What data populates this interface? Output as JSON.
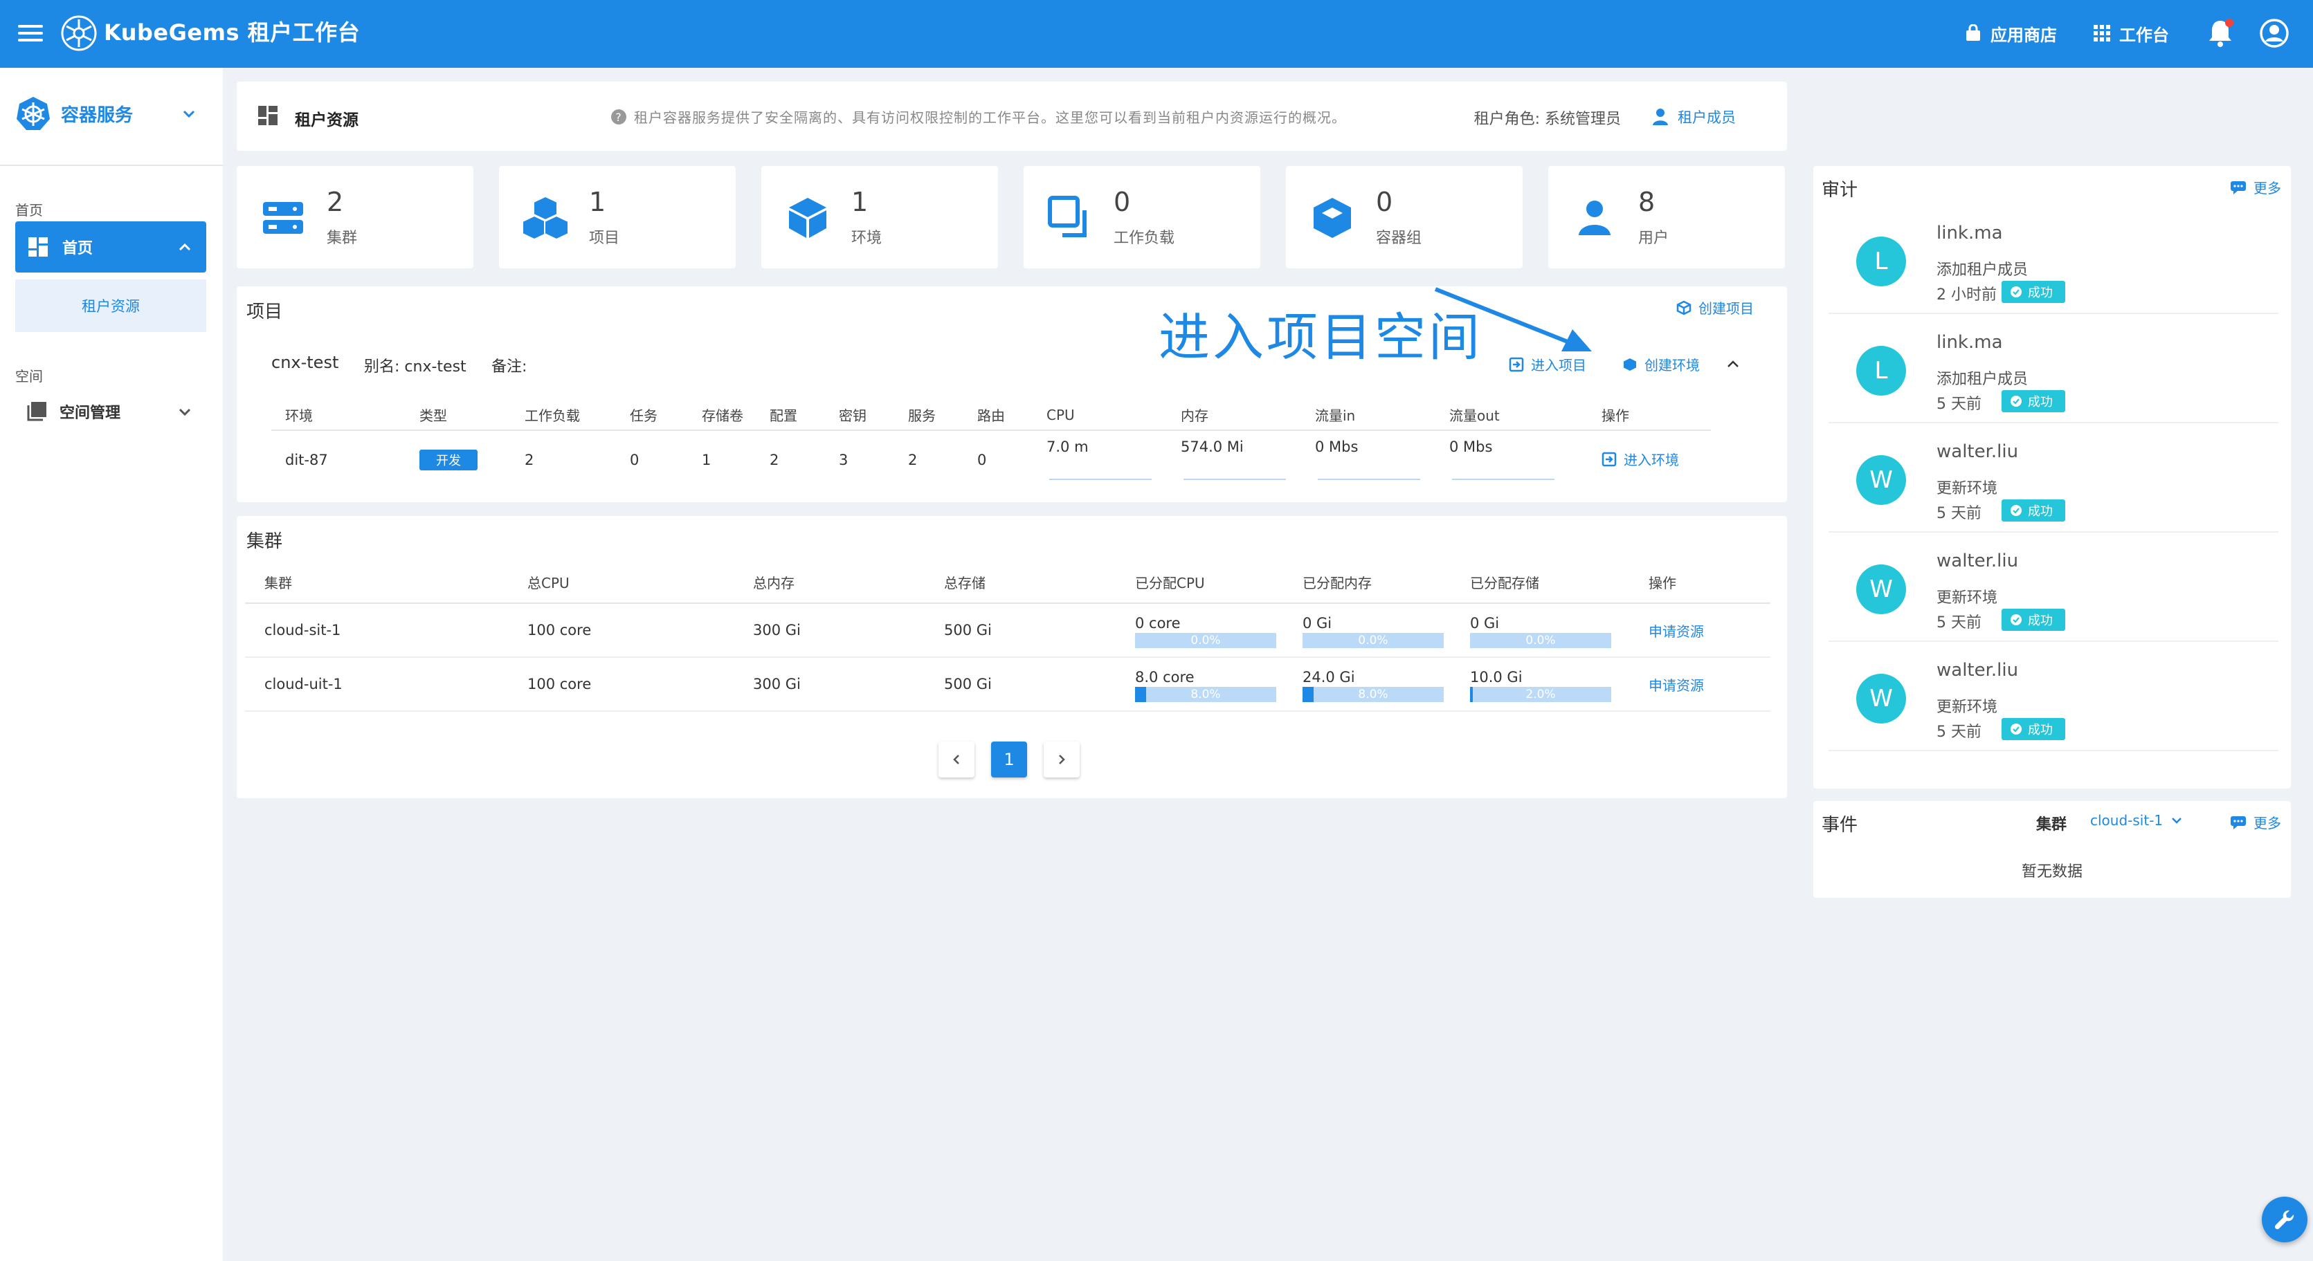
{
  "topbar": {
    "brand": "KubeGems 租户工作台",
    "app_store": "应用商店",
    "workbench": "工作台"
  },
  "sidebar": {
    "project": "容器服务",
    "section_home": "首页",
    "home_label": "首页",
    "home_sub": "租户资源",
    "section_space": "空间",
    "space_mgmt": "空间管理"
  },
  "header": {
    "title": "租户资源",
    "help": "租户容器服务提供了安全隔离的、具有访问权限控制的工作平台。这里您可以看到当前租户内资源运行的概况。",
    "role": "租户角色: 系统管理员",
    "members": "租户成员"
  },
  "stats": [
    {
      "value": "2",
      "label": "集群"
    },
    {
      "value": "1",
      "label": "项目"
    },
    {
      "value": "1",
      "label": "环境"
    },
    {
      "value": "0",
      "label": "工作负载"
    },
    {
      "value": "0",
      "label": "容器组"
    },
    {
      "value": "8",
      "label": "用户"
    }
  ],
  "projects": {
    "title": "项目",
    "create_project": "创建项目",
    "annotation": "进入项目空间",
    "name": "cnx-test",
    "alias": "别名: cnx-test",
    "remark": "备注:",
    "enter_project": "进入项目",
    "create_env": "创建环境",
    "columns": [
      "环境",
      "类型",
      "工作负载",
      "任务",
      "存储卷",
      "配置",
      "密钥",
      "服务",
      "路由",
      "CPU",
      "内存",
      "流量in",
      "流量out",
      "操作"
    ],
    "row": {
      "env": "dit-87",
      "type": "开发",
      "workloads": "2",
      "jobs": "0",
      "volumes": "1",
      "configs": "2",
      "secrets": "3",
      "services": "2",
      "routes": "0",
      "cpu": "7.0 m",
      "memory": "574.0 Mi",
      "traffic_in": "0 Mbs",
      "traffic_out": "0 Mbs",
      "action": "进入环境"
    }
  },
  "clusters": {
    "title": "集群",
    "columns": [
      "集群",
      "总CPU",
      "总内存",
      "总存储",
      "已分配CPU",
      "已分配内存",
      "已分配存储",
      "操作"
    ],
    "rows": [
      {
        "name": "cloud-sit-1",
        "cpu": "100 core",
        "mem": "300 Gi",
        "storage": "500 Gi",
        "alloc_cpu": "0 core",
        "alloc_cpu_pct": "0.0%",
        "alloc_cpu_frac": 0,
        "alloc_mem": "0 Gi",
        "alloc_mem_pct": "0.0%",
        "alloc_mem_frac": 0,
        "alloc_storage": "0 Gi",
        "alloc_storage_pct": "0.0%",
        "alloc_storage_frac": 0,
        "action": "申请资源"
      },
      {
        "name": "cloud-uit-1",
        "cpu": "100 core",
        "mem": "300 Gi",
        "storage": "500 Gi",
        "alloc_cpu": "8.0 core",
        "alloc_cpu_pct": "8.0%",
        "alloc_cpu_frac": 0.08,
        "alloc_mem": "24.0 Gi",
        "alloc_mem_pct": "8.0%",
        "alloc_mem_frac": 0.08,
        "alloc_storage": "10.0 Gi",
        "alloc_storage_pct": "2.0%",
        "alloc_storage_frac": 0.02,
        "action": "申请资源"
      }
    ],
    "page": "1"
  },
  "audit": {
    "title": "审计",
    "more": "更多",
    "items": [
      {
        "initial": "L",
        "user": "link.ma",
        "action": "添加租户成员",
        "time": "2 小时前",
        "status": "成功"
      },
      {
        "initial": "L",
        "user": "link.ma",
        "action": "添加租户成员",
        "time": "5 天前",
        "status": "成功"
      },
      {
        "initial": "W",
        "user": "walter.liu",
        "action": "更新环境",
        "time": "5 天前",
        "status": "成功"
      },
      {
        "initial": "W",
        "user": "walter.liu",
        "action": "更新环境",
        "time": "5 天前",
        "status": "成功"
      },
      {
        "initial": "W",
        "user": "walter.liu",
        "action": "更新环境",
        "time": "5 天前",
        "status": "成功"
      }
    ]
  },
  "events": {
    "title": "事件",
    "cluster_label": "集群",
    "cluster_value": "cloud-sit-1",
    "more": "更多",
    "empty": "暂无数据"
  },
  "colors": {
    "primary": "#1e88e5",
    "avatar": "#26c6da",
    "bg": "#eef1f6"
  }
}
